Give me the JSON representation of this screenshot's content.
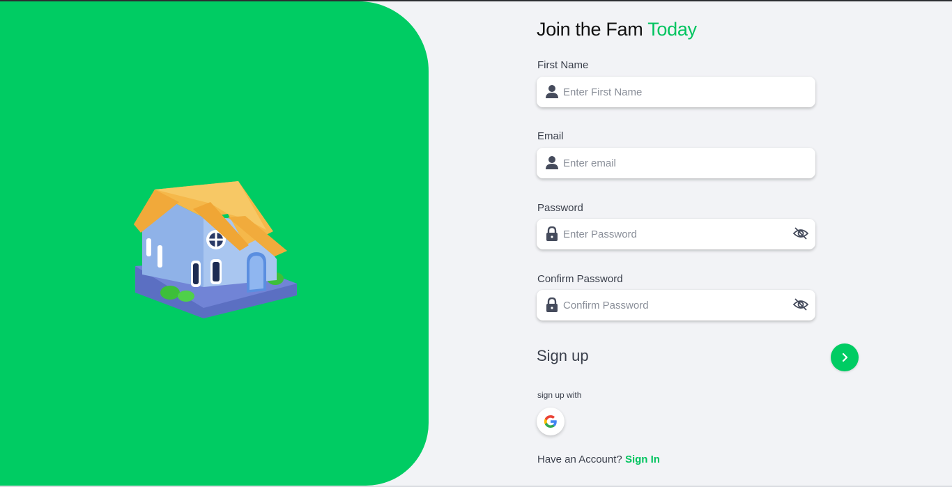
{
  "title": {
    "main": "Join the Fam",
    "accent": "Today"
  },
  "fields": [
    {
      "label": "First Name",
      "placeholder": "Enter First Name",
      "value": "",
      "icon": "user-icon"
    },
    {
      "label": "Email",
      "placeholder": "Enter email",
      "value": "",
      "icon": "user-icon"
    },
    {
      "label": "Password",
      "placeholder": "Enter Password",
      "value": "",
      "icon": "lock-icon",
      "toggle_icon": "eye-off-icon"
    },
    {
      "label": "Confirm Password",
      "placeholder": "Confirm Password",
      "value": "",
      "icon": "lock-icon",
      "toggle_icon": "eye-off-icon"
    }
  ],
  "signup": {
    "label": "Sign up",
    "button_icon": "chevron-right-icon"
  },
  "social": {
    "label": "sign up with",
    "providers": [
      "google-icon"
    ]
  },
  "footer": {
    "text": "Have an Account?",
    "link": "Sign In"
  },
  "illustration": "house-illustration",
  "colors": {
    "accent": "#00cc63",
    "background": "#f2f3f6",
    "field": "#ffffff",
    "text": "#3a3f4b"
  }
}
